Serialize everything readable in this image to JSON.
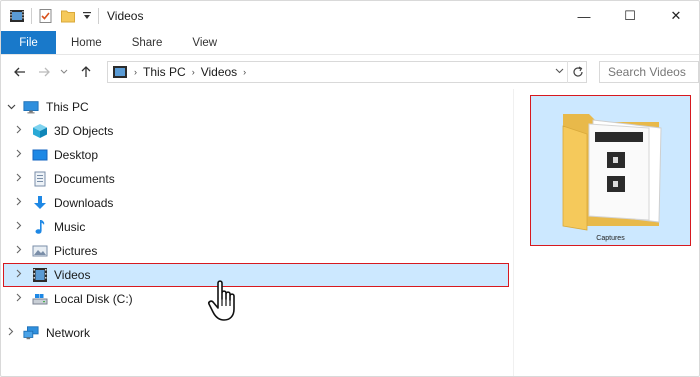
{
  "window": {
    "title": "Videos",
    "controls": {
      "minimize": "—",
      "maximize": "☐",
      "close": "✕"
    }
  },
  "ribbon": {
    "tabs": [
      {
        "label": "File",
        "active": true
      },
      {
        "label": "Home"
      },
      {
        "label": "Share"
      },
      {
        "label": "View"
      }
    ]
  },
  "address": {
    "crumbs": [
      "This PC",
      "Videos"
    ],
    "search_placeholder": "Search Videos"
  },
  "nav_tree": [
    {
      "label": "This PC",
      "icon": "monitor-icon",
      "expanded": true
    },
    {
      "label": "3D Objects",
      "icon": "cube-icon"
    },
    {
      "label": "Desktop",
      "icon": "desktop-icon"
    },
    {
      "label": "Documents",
      "icon": "document-icon"
    },
    {
      "label": "Downloads",
      "icon": "download-arrow-icon"
    },
    {
      "label": "Music",
      "icon": "music-note-icon"
    },
    {
      "label": "Pictures",
      "icon": "pictures-icon"
    },
    {
      "label": "Videos",
      "icon": "film-icon",
      "selected": true
    },
    {
      "label": "Local Disk (C:)",
      "icon": "drive-icon"
    },
    {
      "label": "Network",
      "icon": "network-icon"
    }
  ],
  "content": {
    "items": [
      {
        "label": "Captures",
        "icon": "folder-icon",
        "selected": true
      }
    ]
  },
  "colors": {
    "accent": "#1979ca",
    "selection": "#cce8ff",
    "highlight_border": "#d7191f",
    "folder": "#f5c95b"
  }
}
